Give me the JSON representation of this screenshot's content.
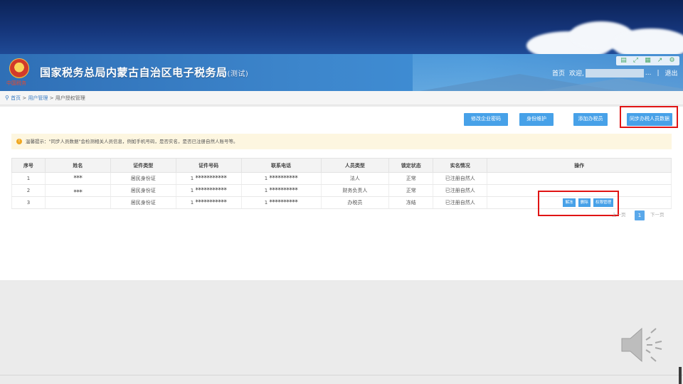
{
  "header": {
    "title": "国家税务总局内蒙古自治区电子税务局",
    "title_sub": "(测试)",
    "emblem_text": "中国税务",
    "home_link": "首页",
    "welcome": "欢迎,",
    "separator": "|",
    "logout": "退出",
    "icons": [
      "doc-icon",
      "expand-icon",
      "qr-icon",
      "share-icon",
      "gear-icon"
    ]
  },
  "breadcrumb": {
    "home": "首页",
    "sep": ">",
    "level1": "用户管理",
    "level2": "用户授权管理"
  },
  "toolbar": {
    "change_password": "修改企业密码",
    "identity_maintain": "身份维护",
    "add_taxpayer": "添加办税员",
    "sync_staff": "同步办税人员数据"
  },
  "notice": {
    "icon": "!",
    "text": "温馨提示：\"同步人员数据\"会检测相关人员信息，例如手机号码，是否实名，是否已注册自然人账号等。"
  },
  "table": {
    "headers": [
      "序号",
      "姓名",
      "证件类型",
      "证件号码",
      "联系电话",
      "人员类型",
      "锁定状态",
      "实名情况",
      "操作"
    ],
    "rows": [
      {
        "no": "1",
        "name": "***",
        "id_type": "居民身份证",
        "id_prefix": "1",
        "id_num": "***********",
        "phone_prefix": "1",
        "phone": "**********",
        "role": "法人",
        "lock": "正常",
        "realname": "已注册自然人"
      },
      {
        "no": "2",
        "name": "***",
        "id_type": "居民身份证",
        "id_prefix": "1",
        "id_num": "***********",
        "phone_prefix": "1",
        "phone": "**********",
        "role": "财务负责人",
        "lock": "正常",
        "realname": "已注册自然人"
      },
      {
        "no": "3",
        "name": "",
        "id_type": "居民身份证",
        "id_prefix": "1",
        "id_num": "***********",
        "phone_prefix": "1",
        "phone": "**********",
        "role": "办税员",
        "lock": "冻结",
        "realname": "已注册自然人"
      }
    ],
    "row3_actions": {
      "unlock": "解冻",
      "delete": "删除",
      "permission": "权限管理"
    }
  },
  "pager": {
    "prev": "上一页",
    "current": "1",
    "next": "下一页"
  },
  "colors": {
    "accent": "#47a1e8",
    "highlight": "#e01414",
    "notice_bg": "#fdf6e0"
  }
}
